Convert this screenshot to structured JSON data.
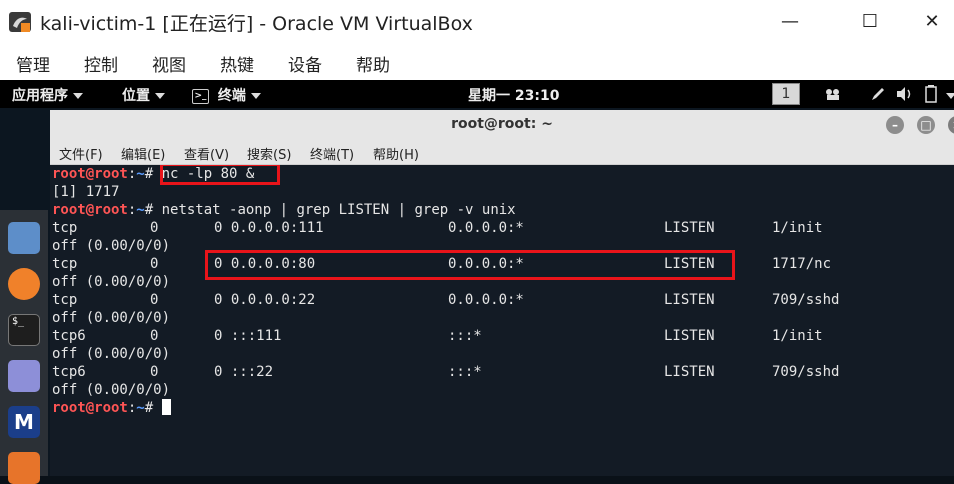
{
  "window": {
    "title": "kali-victim-1 [正在运行] - Oracle VM VirtualBox",
    "minimize": "—",
    "maximize": "☐",
    "close": "✕"
  },
  "vbox_menu": [
    "管理",
    "控制",
    "视图",
    "热键",
    "设备",
    "帮助"
  ],
  "gnome_bar": {
    "apps": "应用程序",
    "places": "位置",
    "terminal": "终端",
    "clock": "星期一 23:10",
    "workspace": "1"
  },
  "dock_icons": [
    "files-icon",
    "firefox-icon",
    "terminal-icon",
    "text-editor-icon",
    "metasploit-icon",
    "app-icon"
  ],
  "terminal": {
    "title": "root@root: ~",
    "menu": [
      "文件(F)",
      "编辑(E)",
      "查看(V)",
      "搜索(S)",
      "终端(T)",
      "帮助(H)"
    ],
    "prompt_user": "root@root",
    "prompt_sep": ":",
    "prompt_path": "~",
    "prompt_hash": "# ",
    "cmd1": "nc -lp 80 &",
    "job": "[1] 1717",
    "cmd2": "netstat -aonp | grep LISTEN | grep -v unix",
    "rows": [
      {
        "proto": "tcp",
        "recv": "0",
        "send_local": "0 0.0.0.0:111",
        "foreign": "0.0.0.0:*",
        "state": "LISTEN",
        "pid": "1/init",
        "timer": "off (0.00/0/0)"
      },
      {
        "proto": "tcp",
        "recv": "0",
        "send_local": "0 0.0.0.0:80",
        "foreign": "0.0.0.0:*",
        "state": "LISTEN",
        "pid": "1717/nc",
        "timer": "off (0.00/0/0)"
      },
      {
        "proto": "tcp",
        "recv": "0",
        "send_local": "0 0.0.0.0:22",
        "foreign": "0.0.0.0:*",
        "state": "LISTEN",
        "pid": "709/sshd",
        "timer": "off (0.00/0/0)"
      },
      {
        "proto": "tcp6",
        "recv": "0",
        "send_local": "0 :::111",
        "foreign": ":::*",
        "state": "LISTEN",
        "pid": "1/init",
        "timer": "off (0.00/0/0)"
      },
      {
        "proto": "tcp6",
        "recv": "0",
        "send_local": "0 :::22",
        "foreign": ":::*",
        "state": "LISTEN",
        "pid": "709/sshd",
        "timer": "off (0.00/0/0)"
      }
    ]
  },
  "colors": {
    "highlight": "#e8141a",
    "prompt_user": "#ff5555",
    "prompt_path": "#5a9cff"
  }
}
